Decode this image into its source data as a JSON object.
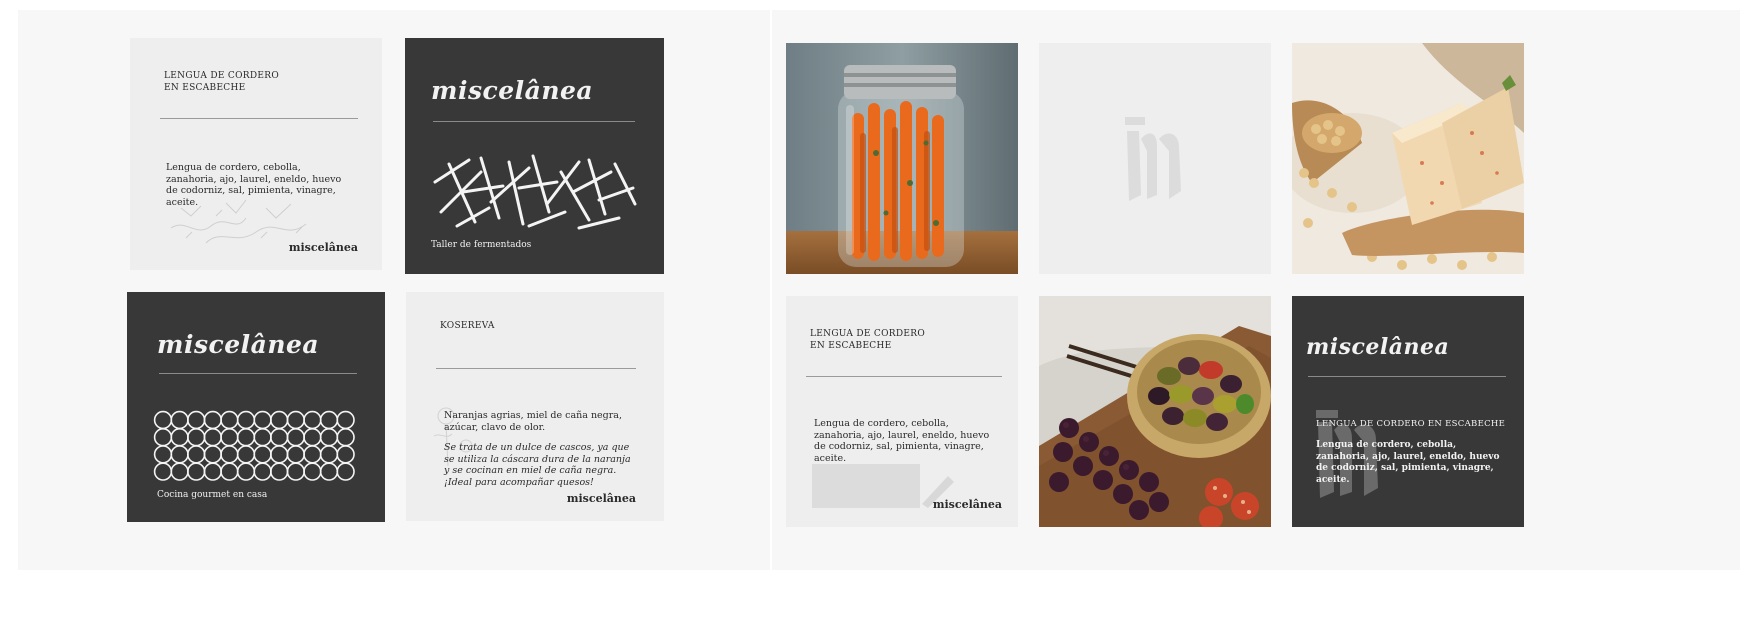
{
  "brand": {
    "name": "miscelânea"
  },
  "left_panel": {
    "card_1": {
      "title_line_1": "LENGUA DE CORDERO",
      "title_line_2": "EN ESCABECHE",
      "body": "Lengua de cordero, cebolla, zanahoria, ajo, laurel, eneldo, huevo de codorniz, sal, pimienta, vinagre, aceite."
    },
    "card_2": {
      "caption": "Taller de fermentados"
    },
    "card_3": {
      "caption": "Cocina gourmet en casa"
    },
    "card_4": {
      "title": "KOSEREVA",
      "body": "Naranjas agrias, miel de caña negra, azúcar, clavo de olor.",
      "italic_body": "Se trata de un dulce de cascos, ya que se utiliza la cáscara dura de la naranja y se cocinan en miel de caña negra. ¡Ideal para acompañar quesos!"
    }
  },
  "right_panel": {
    "card_5": {
      "title_line_1": "LENGUA DE CORDERO",
      "title_line_2": "EN ESCABECHE",
      "body": "Lengua de cordero, cebolla, zanahoria, ajo, laurel, eneldo, huevo de codorniz, sal, pimienta, vinagre, aceite."
    },
    "card_6": {
      "title": "LENGUA DE CORDERO EN ESCABECHE",
      "body": "Lengua de cordero, cebolla, zanahoria, ajo, laurel, eneldo, huevo de codorniz, sal, pimienta, vinagre, aceite."
    }
  },
  "colors": {
    "dark_card": "#383838",
    "light_card": "#eeeeee",
    "panel": "#f7f7f7"
  }
}
